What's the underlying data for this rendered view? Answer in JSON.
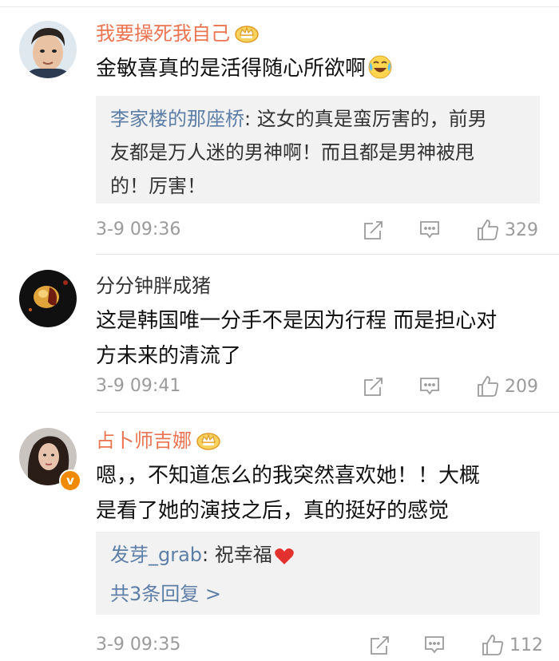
{
  "comments": [
    {
      "username": "我要操死我自己",
      "badge": "crown-icon",
      "text": "金敏喜真的是活得随心所欲啊",
      "text_emoji": "laughing-crying-emoji",
      "reply": {
        "author": "李家楼的那座桥",
        "lines": [
          ": 这女的真是蛮厉害的，前男",
          "友都是万人迷的男神啊！而且都是男神被甩",
          "的！厉害！"
        ]
      },
      "time": "3-9 09:36",
      "likes": "329"
    },
    {
      "username": "分分钟胖成猪",
      "text_lines": [
        "这是韩国唯一分手不是因为行程 而是担心对",
        "方未来的清流了"
      ],
      "time": "3-9 09:41",
      "likes": "209"
    },
    {
      "username": "占卜师吉娜",
      "badge": "crown-icon",
      "verified": "v",
      "text_lines": [
        "嗯，，不知道怎么的我突然喜欢她！！大概",
        "是看了她的演技之后，真的挺好的感觉"
      ],
      "reply": {
        "author": "发芽_grab",
        "text": ": 祝幸福",
        "emoji": "heart-icon",
        "more": "共3条回复 >"
      },
      "time": "3-9 09:35",
      "likes": "112"
    }
  ],
  "colors": {
    "vip_name": "#eb7350",
    "link_blue": "#5d7ea6",
    "meta_gray": "#9b9b9b",
    "reply_bg": "#f2f2f2"
  }
}
